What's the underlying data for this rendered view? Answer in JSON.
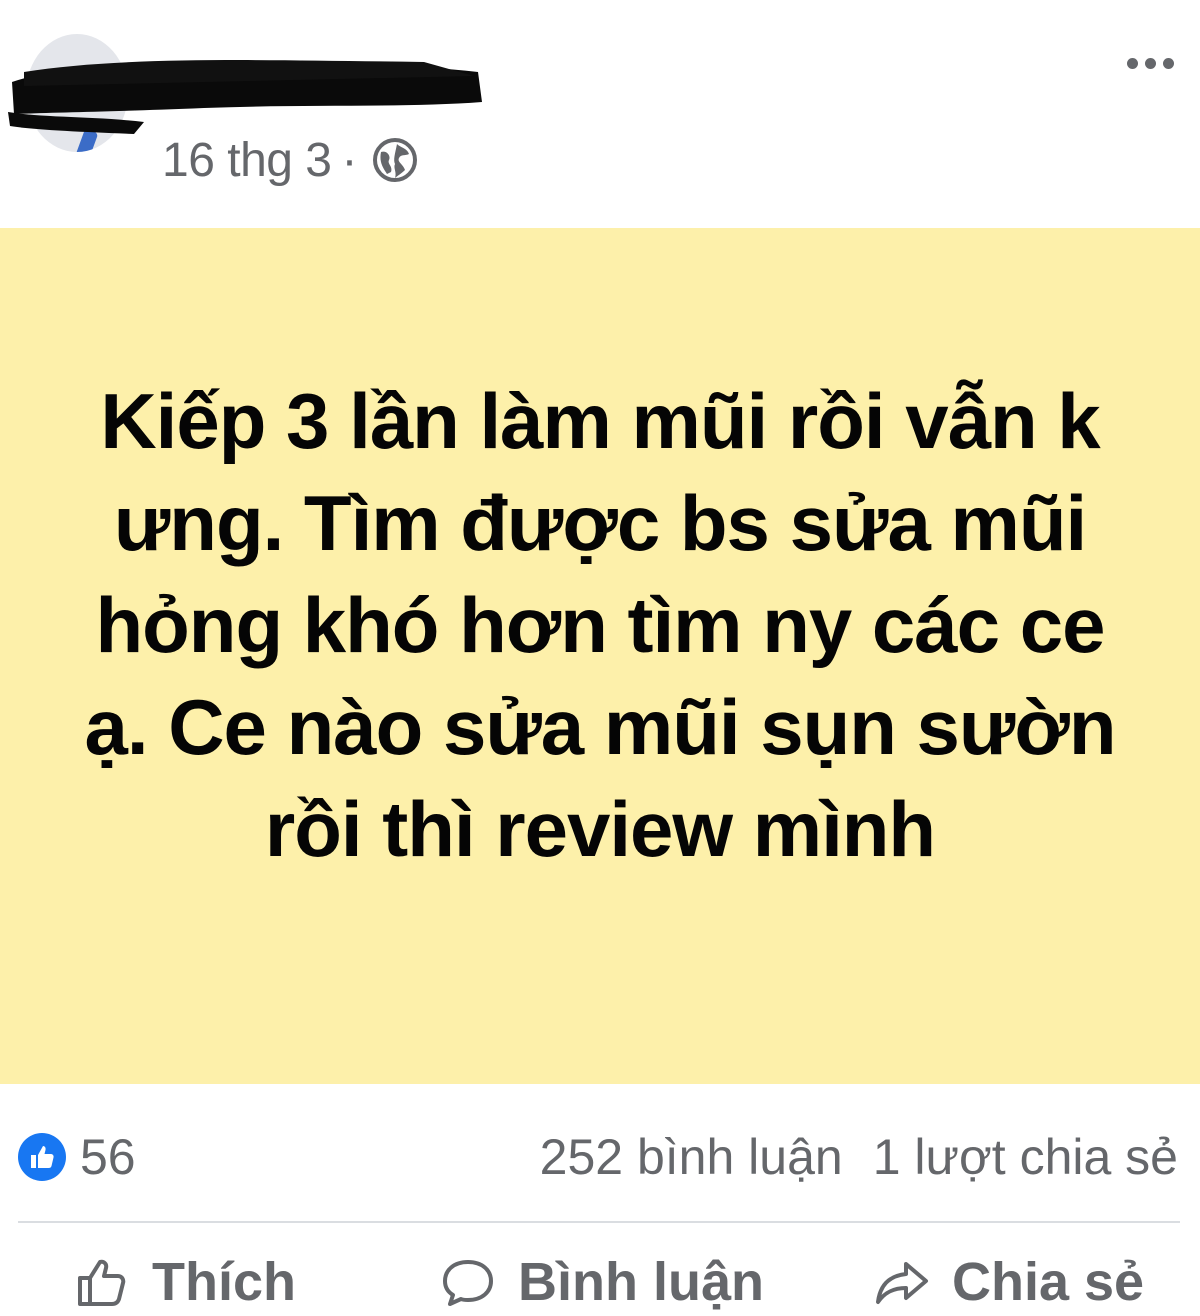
{
  "post": {
    "date": "16 thg 3",
    "separator": "·",
    "privacy_icon": "globe-icon",
    "body_text": "Kiếp 3 lần làm mũi rồi vẫn k ưng. Tìm được bs sửa mũi hỏng khó hơn tìm ny các ce ạ. Ce nào sửa mũi sụn sườn rồi thì review mình",
    "background_color": "#fdf0aa"
  },
  "stats": {
    "likes": "56",
    "comments": "252 bình luận",
    "shares": "1 lượt chia sẻ"
  },
  "actions": {
    "like_label": "Thích",
    "comment_label": "Bình luận",
    "share_label": "Chia sẻ"
  },
  "colors": {
    "accent": "#1877f2",
    "secondary_text": "#65676b"
  }
}
